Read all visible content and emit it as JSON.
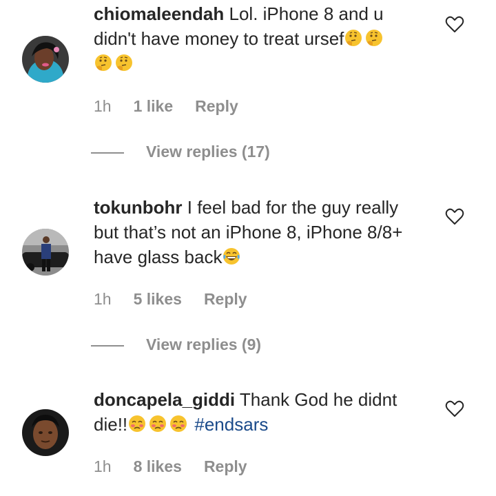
{
  "comments": [
    {
      "username": "chiomaleendah",
      "text_line1": "Lol. iPhone 8 and u",
      "text_line2": "didn't have money to treat ursef",
      "emojis_line2": [
        "thinking-face",
        "thinking-face"
      ],
      "emojis_line3": [
        "thinking-face",
        "thinking-face"
      ],
      "time": "1h",
      "likes": "1 like",
      "reply": "Reply",
      "view_replies": "View replies (17)"
    },
    {
      "username": "tokunbohr",
      "text_line1": "I feel bad for the guy really",
      "text_line2": "but that’s not an iPhone 8, iPhone 8/8+",
      "text_line3": "have glass back",
      "emojis_line3": [
        "grinning-tears"
      ],
      "time": "1h",
      "likes": "5 likes",
      "reply": "Reply",
      "view_replies": "View replies (9)"
    },
    {
      "username": "doncapela_giddi",
      "text_line1": "Thank God he didnt",
      "text_line2": "die!!",
      "emojis_line2": [
        "weary-face",
        "weary-face",
        "weary-face"
      ],
      "hashtag": "#endsars",
      "time": "1h",
      "likes": "8 likes",
      "reply": "Reply"
    }
  ],
  "colors": {
    "text": "#262626",
    "muted": "#8e8e8e",
    "hashtag": "#1a4a8a",
    "emoji": "#f7c32e"
  }
}
